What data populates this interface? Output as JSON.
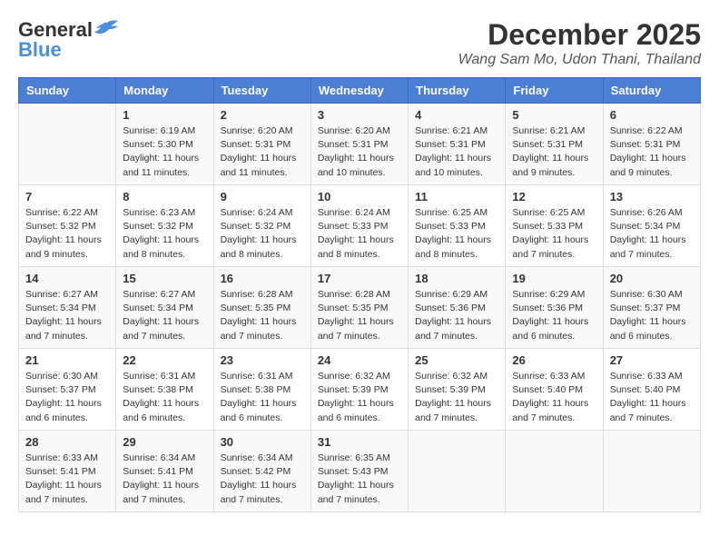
{
  "header": {
    "logo_general": "General",
    "logo_blue": "Blue",
    "month_title": "December 2025",
    "location": "Wang Sam Mo, Udon Thani, Thailand"
  },
  "days_of_week": [
    "Sunday",
    "Monday",
    "Tuesday",
    "Wednesday",
    "Thursday",
    "Friday",
    "Saturday"
  ],
  "weeks": [
    [
      {
        "day": "",
        "content": ""
      },
      {
        "day": "1",
        "content": "Sunrise: 6:19 AM\nSunset: 5:30 PM\nDaylight: 11 hours and 11 minutes."
      },
      {
        "day": "2",
        "content": "Sunrise: 6:20 AM\nSunset: 5:31 PM\nDaylight: 11 hours and 11 minutes."
      },
      {
        "day": "3",
        "content": "Sunrise: 6:20 AM\nSunset: 5:31 PM\nDaylight: 11 hours and 10 minutes."
      },
      {
        "day": "4",
        "content": "Sunrise: 6:21 AM\nSunset: 5:31 PM\nDaylight: 11 hours and 10 minutes."
      },
      {
        "day": "5",
        "content": "Sunrise: 6:21 AM\nSunset: 5:31 PM\nDaylight: 11 hours and 9 minutes."
      },
      {
        "day": "6",
        "content": "Sunrise: 6:22 AM\nSunset: 5:31 PM\nDaylight: 11 hours and 9 minutes."
      }
    ],
    [
      {
        "day": "7",
        "content": "Sunrise: 6:22 AM\nSunset: 5:32 PM\nDaylight: 11 hours and 9 minutes."
      },
      {
        "day": "8",
        "content": "Sunrise: 6:23 AM\nSunset: 5:32 PM\nDaylight: 11 hours and 8 minutes."
      },
      {
        "day": "9",
        "content": "Sunrise: 6:24 AM\nSunset: 5:32 PM\nDaylight: 11 hours and 8 minutes."
      },
      {
        "day": "10",
        "content": "Sunrise: 6:24 AM\nSunset: 5:33 PM\nDaylight: 11 hours and 8 minutes."
      },
      {
        "day": "11",
        "content": "Sunrise: 6:25 AM\nSunset: 5:33 PM\nDaylight: 11 hours and 8 minutes."
      },
      {
        "day": "12",
        "content": "Sunrise: 6:25 AM\nSunset: 5:33 PM\nDaylight: 11 hours and 7 minutes."
      },
      {
        "day": "13",
        "content": "Sunrise: 6:26 AM\nSunset: 5:34 PM\nDaylight: 11 hours and 7 minutes."
      }
    ],
    [
      {
        "day": "14",
        "content": "Sunrise: 6:27 AM\nSunset: 5:34 PM\nDaylight: 11 hours and 7 minutes."
      },
      {
        "day": "15",
        "content": "Sunrise: 6:27 AM\nSunset: 5:34 PM\nDaylight: 11 hours and 7 minutes."
      },
      {
        "day": "16",
        "content": "Sunrise: 6:28 AM\nSunset: 5:35 PM\nDaylight: 11 hours and 7 minutes."
      },
      {
        "day": "17",
        "content": "Sunrise: 6:28 AM\nSunset: 5:35 PM\nDaylight: 11 hours and 7 minutes."
      },
      {
        "day": "18",
        "content": "Sunrise: 6:29 AM\nSunset: 5:36 PM\nDaylight: 11 hours and 7 minutes."
      },
      {
        "day": "19",
        "content": "Sunrise: 6:29 AM\nSunset: 5:36 PM\nDaylight: 11 hours and 6 minutes."
      },
      {
        "day": "20",
        "content": "Sunrise: 6:30 AM\nSunset: 5:37 PM\nDaylight: 11 hours and 6 minutes."
      }
    ],
    [
      {
        "day": "21",
        "content": "Sunrise: 6:30 AM\nSunset: 5:37 PM\nDaylight: 11 hours and 6 minutes."
      },
      {
        "day": "22",
        "content": "Sunrise: 6:31 AM\nSunset: 5:38 PM\nDaylight: 11 hours and 6 minutes."
      },
      {
        "day": "23",
        "content": "Sunrise: 6:31 AM\nSunset: 5:38 PM\nDaylight: 11 hours and 6 minutes."
      },
      {
        "day": "24",
        "content": "Sunrise: 6:32 AM\nSunset: 5:39 PM\nDaylight: 11 hours and 6 minutes."
      },
      {
        "day": "25",
        "content": "Sunrise: 6:32 AM\nSunset: 5:39 PM\nDaylight: 11 hours and 7 minutes."
      },
      {
        "day": "26",
        "content": "Sunrise: 6:33 AM\nSunset: 5:40 PM\nDaylight: 11 hours and 7 minutes."
      },
      {
        "day": "27",
        "content": "Sunrise: 6:33 AM\nSunset: 5:40 PM\nDaylight: 11 hours and 7 minutes."
      }
    ],
    [
      {
        "day": "28",
        "content": "Sunrise: 6:33 AM\nSunset: 5:41 PM\nDaylight: 11 hours and 7 minutes."
      },
      {
        "day": "29",
        "content": "Sunrise: 6:34 AM\nSunset: 5:41 PM\nDaylight: 11 hours and 7 minutes."
      },
      {
        "day": "30",
        "content": "Sunrise: 6:34 AM\nSunset: 5:42 PM\nDaylight: 11 hours and 7 minutes."
      },
      {
        "day": "31",
        "content": "Sunrise: 6:35 AM\nSunset: 5:43 PM\nDaylight: 11 hours and 7 minutes."
      },
      {
        "day": "",
        "content": ""
      },
      {
        "day": "",
        "content": ""
      },
      {
        "day": "",
        "content": ""
      }
    ]
  ]
}
